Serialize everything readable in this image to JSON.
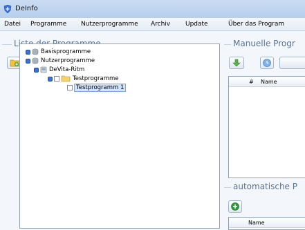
{
  "window": {
    "title": "DeInfo",
    "brand_color": "#3b72d8"
  },
  "menu": {
    "items": [
      {
        "label": "Datei"
      },
      {
        "label": "Programme"
      },
      {
        "label": "Nutzerprogramme"
      },
      {
        "label": "Archiv"
      },
      {
        "label": "Update"
      },
      {
        "label": "Über das Program"
      }
    ]
  },
  "left_group": {
    "title": "Liste der Programme",
    "toolbar_icons": [
      "folder-add-icon",
      "plus-circle-icon",
      "edit-note-icon",
      "delete-x-icon",
      "arrow-right-icon"
    ]
  },
  "tree": {
    "nodes": [
      {
        "label": "Basisprogramme",
        "icon": "database-icon"
      },
      {
        "label": "Nutzerprogramme",
        "icon": "database-icon"
      },
      {
        "label": "DeVita-Ritm",
        "icon": "device-icon"
      },
      {
        "label": "Testprogramme",
        "icon": "folder-icon"
      },
      {
        "label": "Testprogramm 1",
        "icon": "",
        "selected": true
      }
    ]
  },
  "right_group": {
    "title": "Manuelle Progr",
    "toolbar_icons": [
      "arrow-down-icon",
      "clock-icon"
    ],
    "table_headers": [
      "#",
      "Name"
    ]
  },
  "auto_group": {
    "title": "automatische P",
    "toolbar_icons": [
      "plus-circle-icon"
    ],
    "table_headers": [
      "Name"
    ]
  }
}
